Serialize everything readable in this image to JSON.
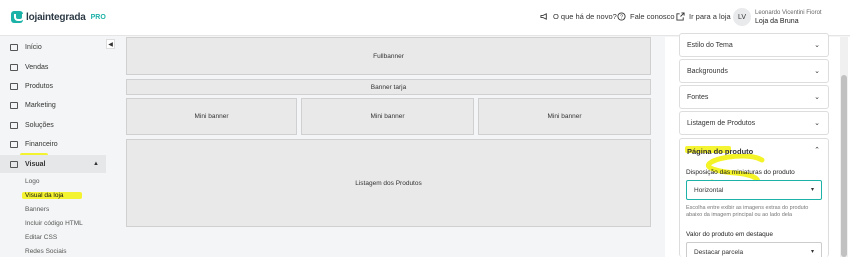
{
  "brand": {
    "name": "lojaintegrada",
    "tier": "PRO",
    "accent": "#1db2a8"
  },
  "header": {
    "whats_new": "O que há de novo?",
    "contact": "Fale conosco",
    "go_to_store": "Ir para a loja",
    "avatar_initials": "LV",
    "user_name": "Leonardo Vicentini Fiorot",
    "store_name": "Loja da Bruna"
  },
  "sidebar": {
    "items": [
      {
        "label": "Início",
        "icon": "home-icon"
      },
      {
        "label": "Vendas",
        "icon": "cart-icon"
      },
      {
        "label": "Produtos",
        "icon": "box-icon"
      },
      {
        "label": "Marketing",
        "icon": "megaphone-icon"
      },
      {
        "label": "Soluções",
        "icon": "grid-icon"
      },
      {
        "label": "Financeiro",
        "icon": "money-icon"
      },
      {
        "label": "Visual",
        "icon": "monitor-icon"
      }
    ],
    "visual_subitems": [
      "Logo",
      "Visual da loja",
      "Banners",
      "Incluir código HTML",
      "Editar CSS",
      "Redes Sociais"
    ],
    "highlight_color": "#f3f20e"
  },
  "canvas": {
    "fullbanner": "Fullbanner",
    "banner_tarja": "Banner tarja",
    "mini_banners": [
      "Mini banner",
      "Mini banner",
      "Mini banner"
    ],
    "product_listing": "Listagem dos Produtos"
  },
  "panel": {
    "sections": [
      "Estilo do Tema",
      "Backgrounds",
      "Fontes",
      "Listagem de Produtos"
    ],
    "open_section": "Página do produto",
    "thumbs_label": "Disposição das miniaturas do produto",
    "thumbs_value": "Horizontal",
    "thumbs_help": "Escolha entre exibir as imagens extras do produto abaixo da imagem principal ou ao lado dela",
    "highlight_label": "Valor do produto em destaque",
    "highlight_value": "Destacar parcela"
  }
}
